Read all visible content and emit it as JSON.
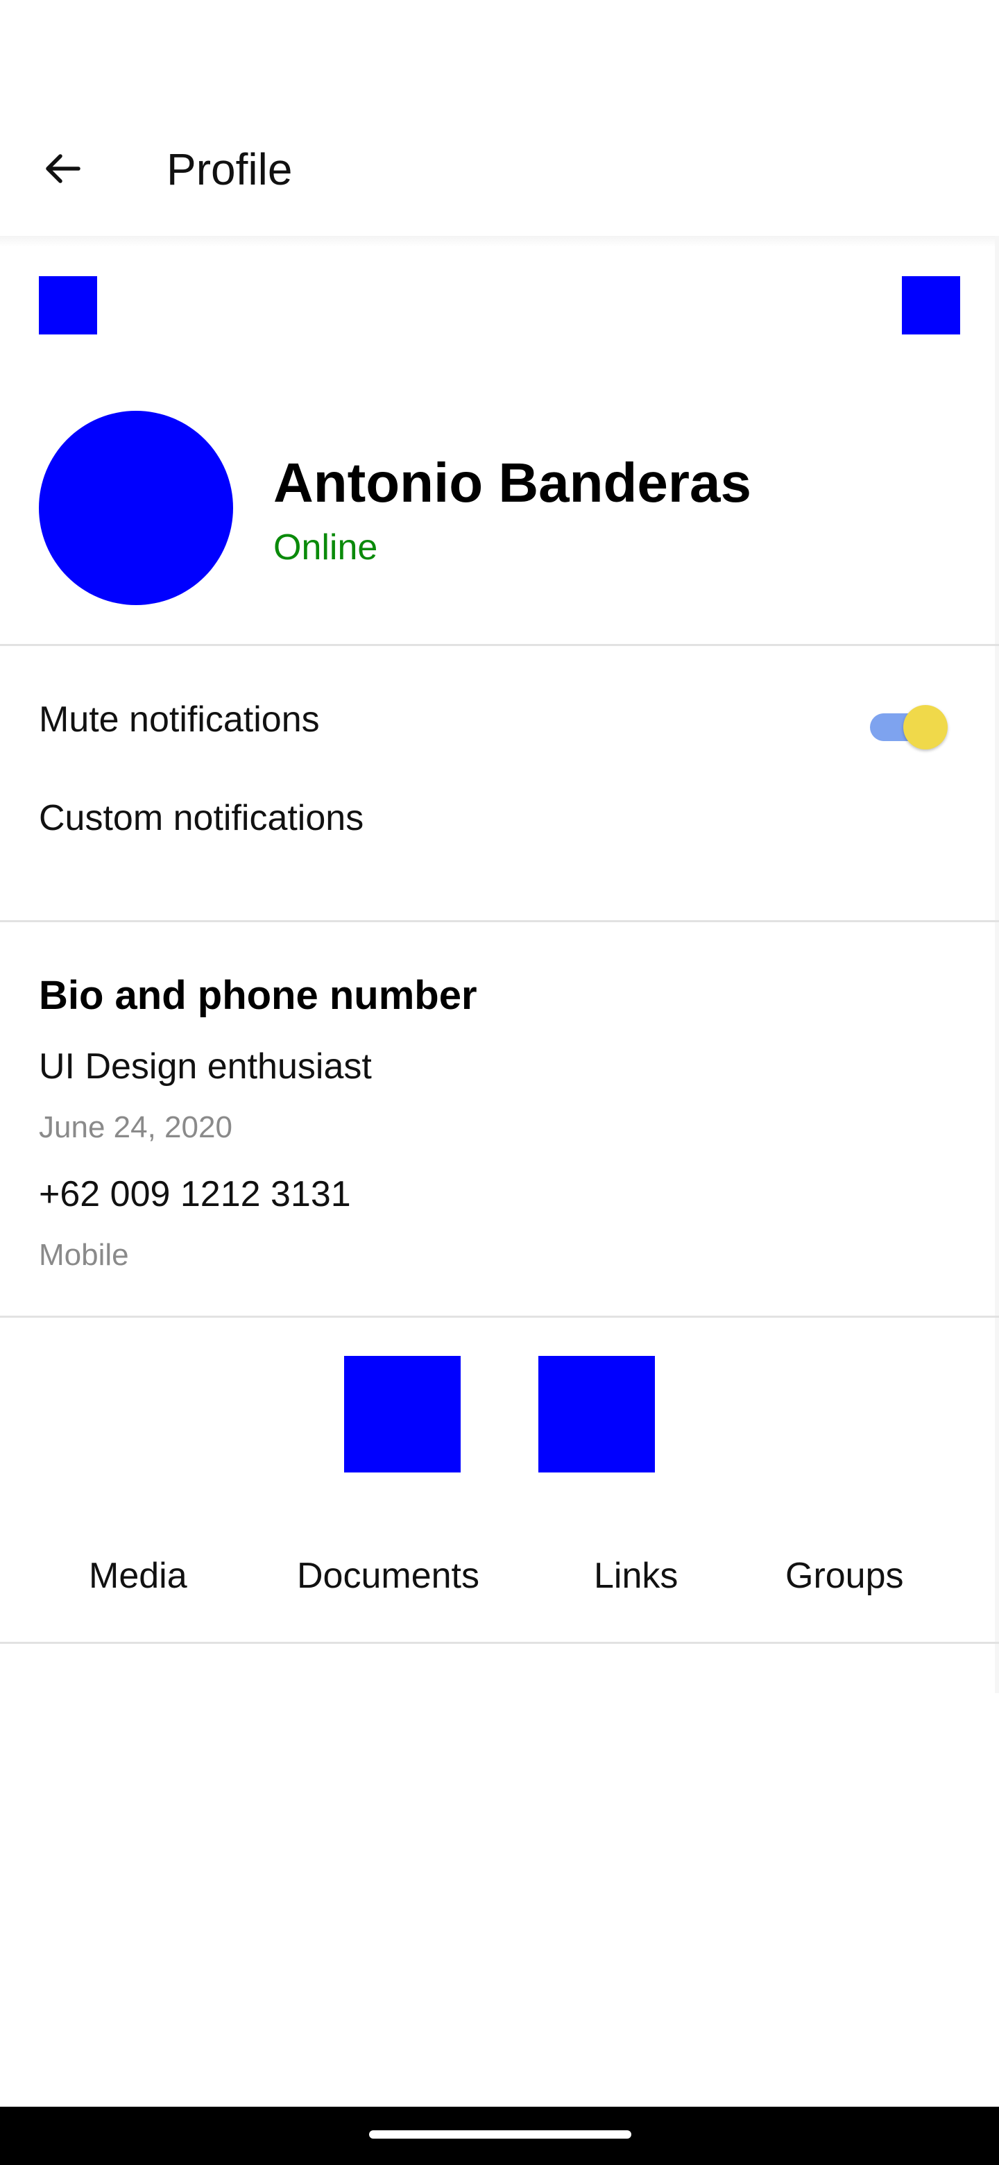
{
  "appbar": {
    "title": "Profile",
    "back_icon": "arrow-left-icon"
  },
  "profile": {
    "name": "Antonio Banderas",
    "status": "Online",
    "status_color": "#0a8a0a",
    "avatar_color": "#0000ff"
  },
  "notifications": {
    "mute_label": "Mute notifications",
    "mute_enabled": true,
    "custom_label": "Custom notifications",
    "toggle_track_color": "#7ea3ef",
    "toggle_thumb_color": "#f0d94a"
  },
  "bio": {
    "section_title": "Bio and phone number",
    "bio_text": "UI Design enthusiast",
    "bio_date": "June 24, 2020",
    "phone": "+62 009 1212 3131",
    "phone_type": "Mobile"
  },
  "tabs": [
    {
      "label": "Media"
    },
    {
      "label": "Documents"
    },
    {
      "label": "Links"
    },
    {
      "label": "Groups"
    }
  ],
  "colors": {
    "placeholder_blue": "#0000ff",
    "divider": "#e2e2e2",
    "secondary_text": "#8a8a8a"
  }
}
